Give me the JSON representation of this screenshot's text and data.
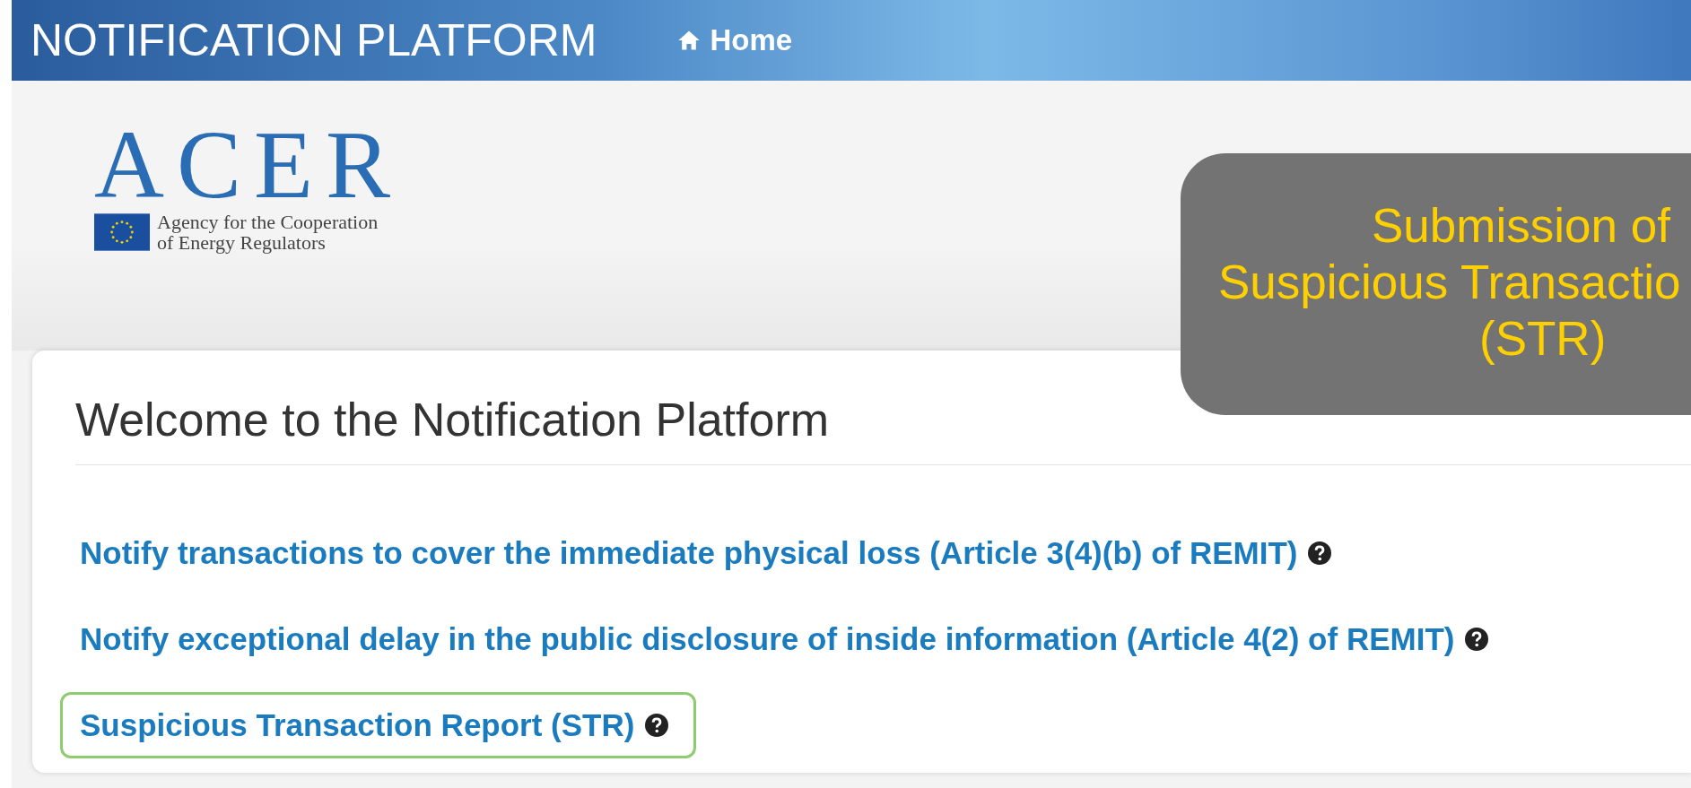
{
  "header": {
    "title": "NOTIFICATION PLATFORM",
    "nav": [
      {
        "label": "Home",
        "kind": "home"
      }
    ]
  },
  "logo": {
    "name": "ACER",
    "tagline": [
      "Agency for the Cooperation",
      "of Energy Regulators"
    ]
  },
  "callout": {
    "lines": [
      "Submission of",
      "Suspicious Transactio",
      "(STR)"
    ]
  },
  "panel": {
    "title": "Welcome to the Notification Platform",
    "links": [
      {
        "label": "Notify transactions to cover the immediate physical loss (Article 3(4)(b) of REMIT)",
        "highlighted": false
      },
      {
        "label": "Notify exceptional delay in the public disclosure of inside information (Article 4(2) of REMIT)",
        "highlighted": false
      },
      {
        "label": "Suspicious Transaction Report (STR)",
        "highlighted": true
      }
    ]
  }
}
